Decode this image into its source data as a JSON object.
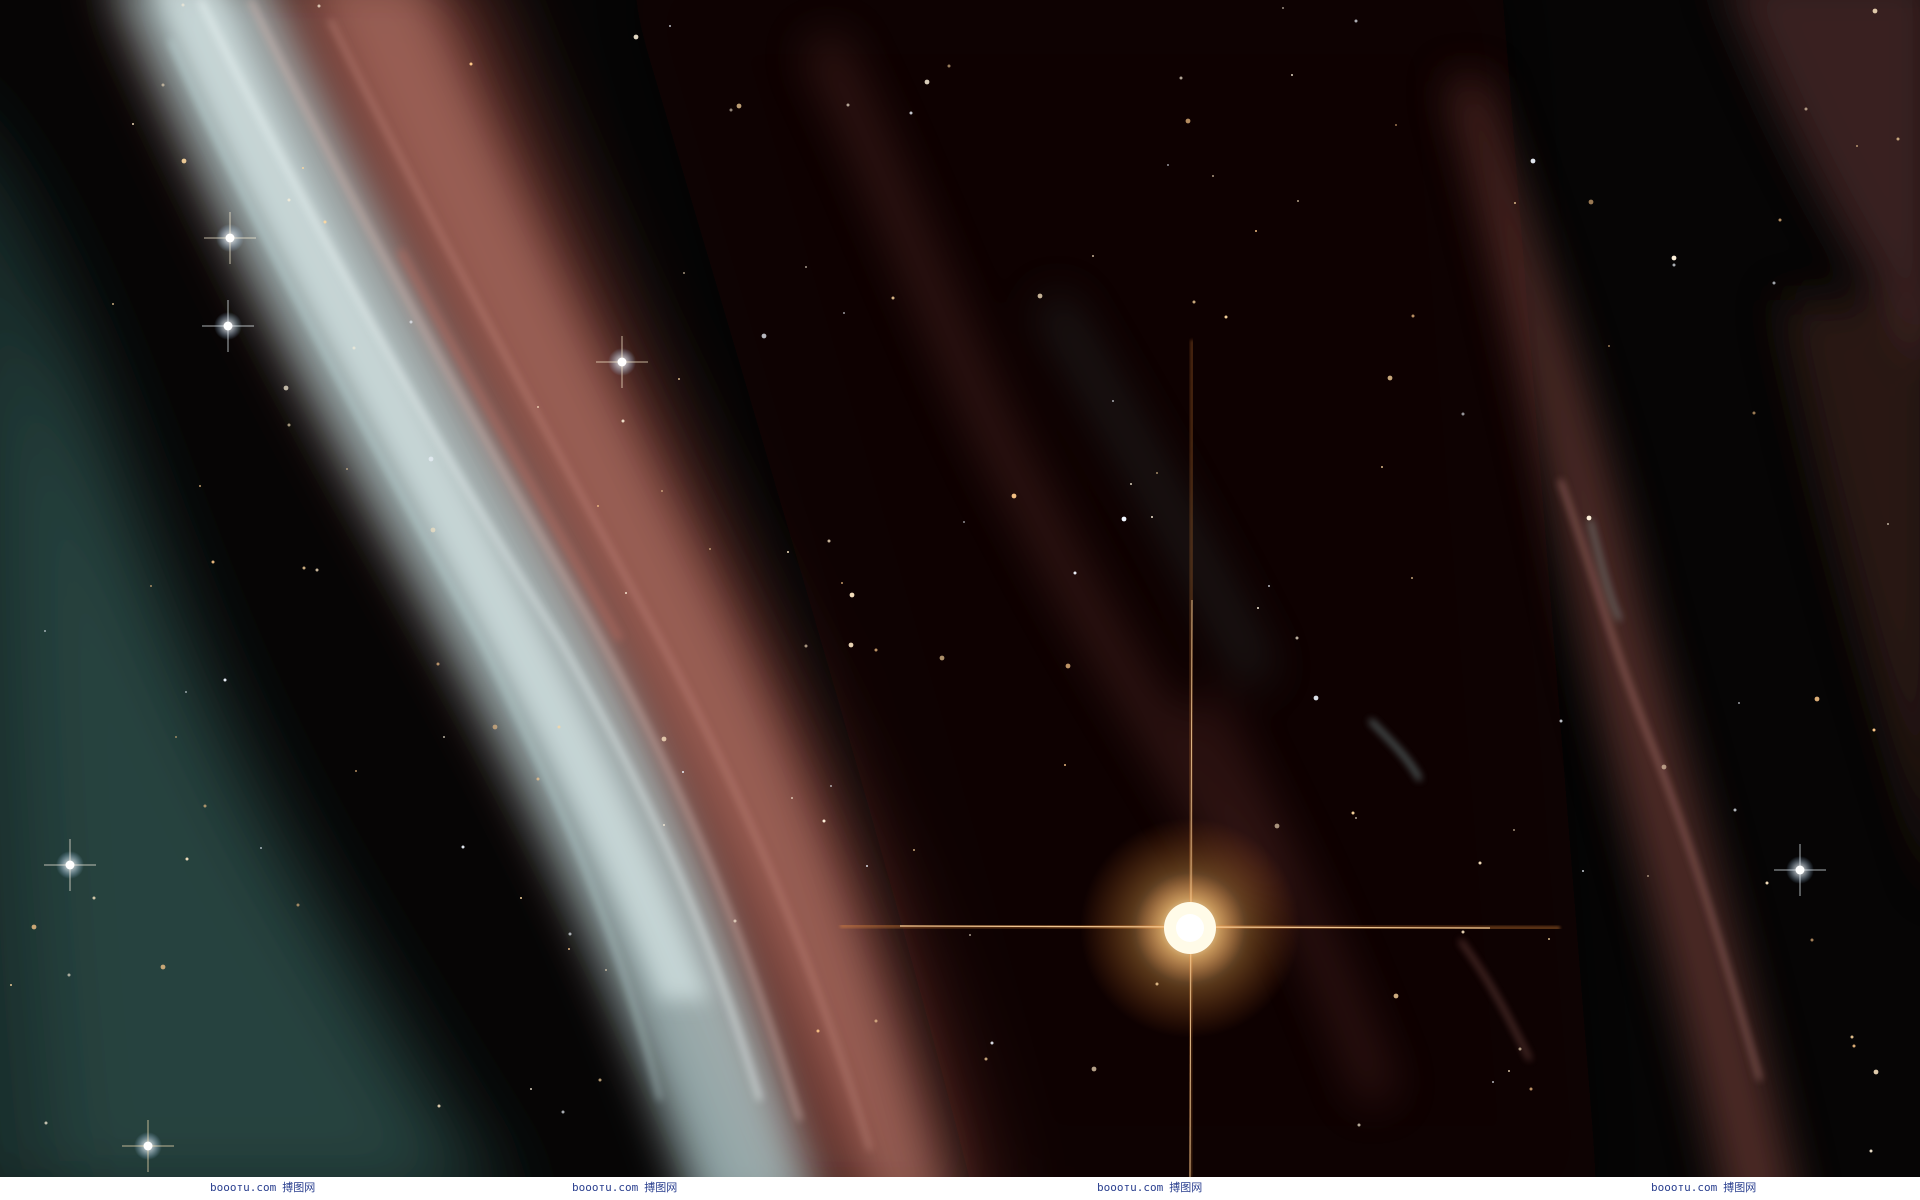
{
  "image": {
    "subject": "nebula-starfield",
    "palette": {
      "background": "#050404",
      "filament_pink": "#c98579",
      "filament_cyan": "#bfe3e6",
      "filament_teal": "#2f5a55",
      "star_warm": "#ffd9a0",
      "star_bright": "#fff6e0",
      "spike_orange": "#ff9a40"
    }
  },
  "watermark": {
    "items": [
      {
        "domain": "booотu.com",
        "label": "搏图网"
      },
      {
        "domain": "booотu.com",
        "label": "搏图网"
      },
      {
        "domain": "booотu.com",
        "label": "搏图网"
      },
      {
        "domain": "booотu.com",
        "label": "搏图网"
      }
    ]
  }
}
